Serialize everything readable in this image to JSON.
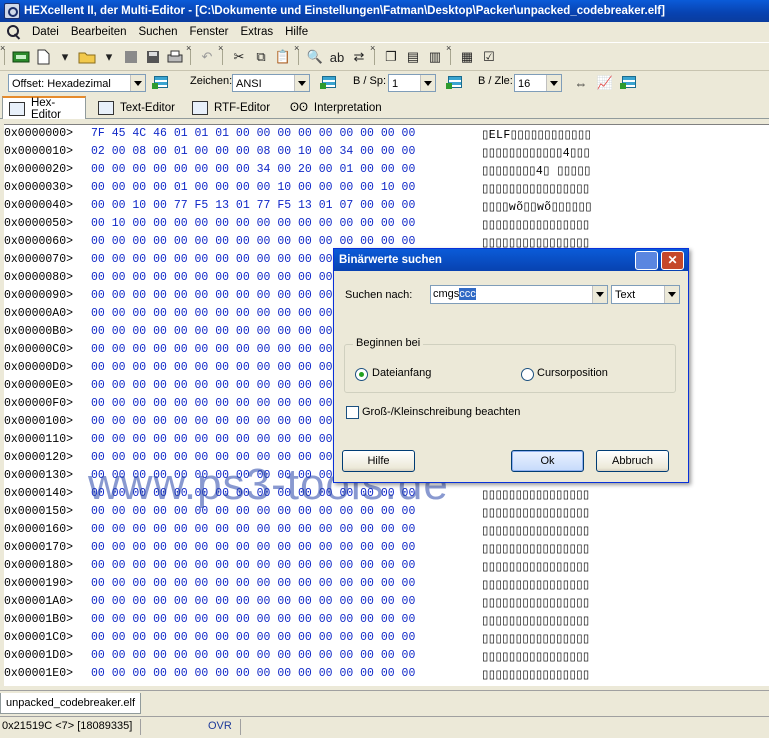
{
  "window": {
    "title": "HEXcellent II, der Multi-Editor - [C:\\Dokumente und Einstellungen\\Fatman\\Desktop\\Packer\\unpacked_codebreaker.elf]"
  },
  "menu": [
    "Datei",
    "Bearbeiten",
    "Suchen",
    "Fenster",
    "Extras",
    "Hilfe"
  ],
  "toolbar2": {
    "offset_value": "Offset: Hexadezimal",
    "zeichen_label": "Zeichen:",
    "zeichen_value": "ANSI",
    "bsp_label": "B / Sp:",
    "bsp_value": "1",
    "bzle_label": "B / Zle:",
    "bzle_value": "16"
  },
  "tabs": [
    "Hex-Editor",
    "Text-Editor",
    "RTF-Editor",
    "Interpretation"
  ],
  "hex_rows": [
    {
      "addr": "0x0000000>",
      "hex": "7F 45 4C 46 01 01 01 00 00 00 00 00 00 00 00 00",
      "ascii": "▯ELF▯▯▯▯▯▯▯▯▯▯▯▯"
    },
    {
      "addr": "0x0000010>",
      "hex": "02 00 08 00 01 00 00 00 08 00 10 00 34 00 00 00",
      "ascii": "▯▯▯▯▯▯▯▯▯▯▯▯4▯▯▯"
    },
    {
      "addr": "0x0000020>",
      "hex": "00 00 00 00 00 00 00 00 34 00 20 00 01 00 00 00",
      "ascii": "▯▯▯▯▯▯▯▯4▯ ▯▯▯▯▯"
    },
    {
      "addr": "0x0000030>",
      "hex": "00 00 00 00 01 00 00 00 00 10 00 00 00 00 10 00",
      "ascii": "▯▯▯▯▯▯▯▯▯▯▯▯▯▯▯▯"
    },
    {
      "addr": "0x0000040>",
      "hex": "00 00 10 00 77 F5 13 01 77 F5 13 01 07 00 00 00",
      "ascii": "▯▯▯▯wõ▯▯wõ▯▯▯▯▯▯"
    },
    {
      "addr": "0x0000050>",
      "hex": "00 10 00 00 00 00 00 00 00 00 00 00 00 00 00 00",
      "ascii": "▯▯▯▯▯▯▯▯▯▯▯▯▯▯▯▯"
    },
    {
      "addr": "0x0000060>",
      "hex": "00 00 00 00 00 00 00 00 00 00 00 00 00 00 00 00",
      "ascii": "▯▯▯▯▯▯▯▯▯▯▯▯▯▯▯▯"
    },
    {
      "addr": "0x0000070>",
      "hex": "00 00 00 00 00 00 00 00 00 00 00 00 00 00 00 00",
      "ascii": "▯▯▯▯▯▯▯▯▯▯▯▯▯▯▯▯"
    },
    {
      "addr": "0x0000080>",
      "hex": "00 00 00 00 00 00 00 00 00 00 00 00 00 00 00 00",
      "ascii": "▯▯▯▯▯▯▯▯▯▯▯▯▯▯▯▯"
    },
    {
      "addr": "0x0000090>",
      "hex": "00 00 00 00 00 00 00 00 00 00 00 00 00 00 00 00",
      "ascii": "▯▯▯▯▯▯▯▯▯▯▯▯▯▯▯▯"
    },
    {
      "addr": "0x00000A0>",
      "hex": "00 00 00 00 00 00 00 00 00 00 00 00 00 00 00 00",
      "ascii": "▯▯▯▯▯▯▯▯▯▯▯▯▯▯▯▯"
    },
    {
      "addr": "0x00000B0>",
      "hex": "00 00 00 00 00 00 00 00 00 00 00 00 00 00 00 00",
      "ascii": "▯▯▯▯▯▯▯▯▯▯▯▯▯▯▯▯"
    },
    {
      "addr": "0x00000C0>",
      "hex": "00 00 00 00 00 00 00 00 00 00 00 00 00 00 00 00",
      "ascii": "▯▯▯▯▯▯▯▯▯▯▯▯▯▯▯▯"
    },
    {
      "addr": "0x00000D0>",
      "hex": "00 00 00 00 00 00 00 00 00 00 00 00 00 00 00 00",
      "ascii": "▯▯▯▯▯▯▯▯▯▯▯▯▯▯▯▯"
    },
    {
      "addr": "0x00000E0>",
      "hex": "00 00 00 00 00 00 00 00 00 00 00 00 00 00 00 00",
      "ascii": "▯▯▯▯▯▯▯▯▯▯▯▯▯▯▯▯"
    },
    {
      "addr": "0x00000F0>",
      "hex": "00 00 00 00 00 00 00 00 00 00 00 00 00 00 00 00",
      "ascii": "▯▯▯▯▯▯▯▯▯▯▯▯▯▯▯▯"
    },
    {
      "addr": "0x0000100>",
      "hex": "00 00 00 00 00 00 00 00 00 00 00 00 00 00 00 00",
      "ascii": "▯▯▯▯▯▯▯▯▯▯▯▯▯▯▯▯"
    },
    {
      "addr": "0x0000110>",
      "hex": "00 00 00 00 00 00 00 00 00 00 00 00 00 00 00 00",
      "ascii": "▯▯▯▯▯▯▯▯▯▯▯▯▯▯▯▯"
    },
    {
      "addr": "0x0000120>",
      "hex": "00 00 00 00 00 00 00 00 00 00 00 00 00 00 00 00",
      "ascii": "▯▯▯▯▯▯▯▯▯▯▯▯▯▯▯▯"
    },
    {
      "addr": "0x0000130>",
      "hex": "00 00 00 00 00 00 00 00 00 00 00 00 00 00 00 00",
      "ascii": "▯▯▯▯▯▯▯▯▯▯▯▯▯▯▯▯"
    },
    {
      "addr": "0x0000140>",
      "hex": "00 00 00 00 00 00 00 00 00 00 00 00 00 00 00 00",
      "ascii": "▯▯▯▯▯▯▯▯▯▯▯▯▯▯▯▯"
    },
    {
      "addr": "0x0000150>",
      "hex": "00 00 00 00 00 00 00 00 00 00 00 00 00 00 00 00",
      "ascii": "▯▯▯▯▯▯▯▯▯▯▯▯▯▯▯▯"
    },
    {
      "addr": "0x0000160>",
      "hex": "00 00 00 00 00 00 00 00 00 00 00 00 00 00 00 00",
      "ascii": "▯▯▯▯▯▯▯▯▯▯▯▯▯▯▯▯"
    },
    {
      "addr": "0x0000170>",
      "hex": "00 00 00 00 00 00 00 00 00 00 00 00 00 00 00 00",
      "ascii": "▯▯▯▯▯▯▯▯▯▯▯▯▯▯▯▯"
    },
    {
      "addr": "0x0000180>",
      "hex": "00 00 00 00 00 00 00 00 00 00 00 00 00 00 00 00",
      "ascii": "▯▯▯▯▯▯▯▯▯▯▯▯▯▯▯▯"
    },
    {
      "addr": "0x0000190>",
      "hex": "00 00 00 00 00 00 00 00 00 00 00 00 00 00 00 00",
      "ascii": "▯▯▯▯▯▯▯▯▯▯▯▯▯▯▯▯"
    },
    {
      "addr": "0x00001A0>",
      "hex": "00 00 00 00 00 00 00 00 00 00 00 00 00 00 00 00",
      "ascii": "▯▯▯▯▯▯▯▯▯▯▯▯▯▯▯▯"
    },
    {
      "addr": "0x00001B0>",
      "hex": "00 00 00 00 00 00 00 00 00 00 00 00 00 00 00 00",
      "ascii": "▯▯▯▯▯▯▯▯▯▯▯▯▯▯▯▯"
    },
    {
      "addr": "0x00001C0>",
      "hex": "00 00 00 00 00 00 00 00 00 00 00 00 00 00 00 00",
      "ascii": "▯▯▯▯▯▯▯▯▯▯▯▯▯▯▯▯"
    },
    {
      "addr": "0x00001D0>",
      "hex": "00 00 00 00 00 00 00 00 00 00 00 00 00 00 00 00",
      "ascii": "▯▯▯▯▯▯▯▯▯▯▯▯▯▯▯▯"
    },
    {
      "addr": "0x00001E0>",
      "hex": "00 00 00 00 00 00 00 00 00 00 00 00 00 00 00 00",
      "ascii": "▯▯▯▯▯▯▯▯▯▯▯▯▯▯▯▯"
    }
  ],
  "watermark": "www.ps3-tools.de",
  "dialog": {
    "title": "Binärwerte suchen",
    "search_label": "Suchen nach:",
    "search_value_plain": "cmgs",
    "search_value_selected": "ccc",
    "type_value": "Text",
    "group_label": "Beginnen bei",
    "radio1": "Dateianfang",
    "radio2": "Cursorposition",
    "checkbox": "Groß-/Kleinschreibung beachten",
    "help_button": "Hilfe",
    "ok_button": "Ok",
    "cancel_button": "Abbruch"
  },
  "document_tab": "unpacked_codebreaker.elf",
  "status": {
    "position": "0x21519C <7> [18089335]",
    "mode": "OVR"
  }
}
